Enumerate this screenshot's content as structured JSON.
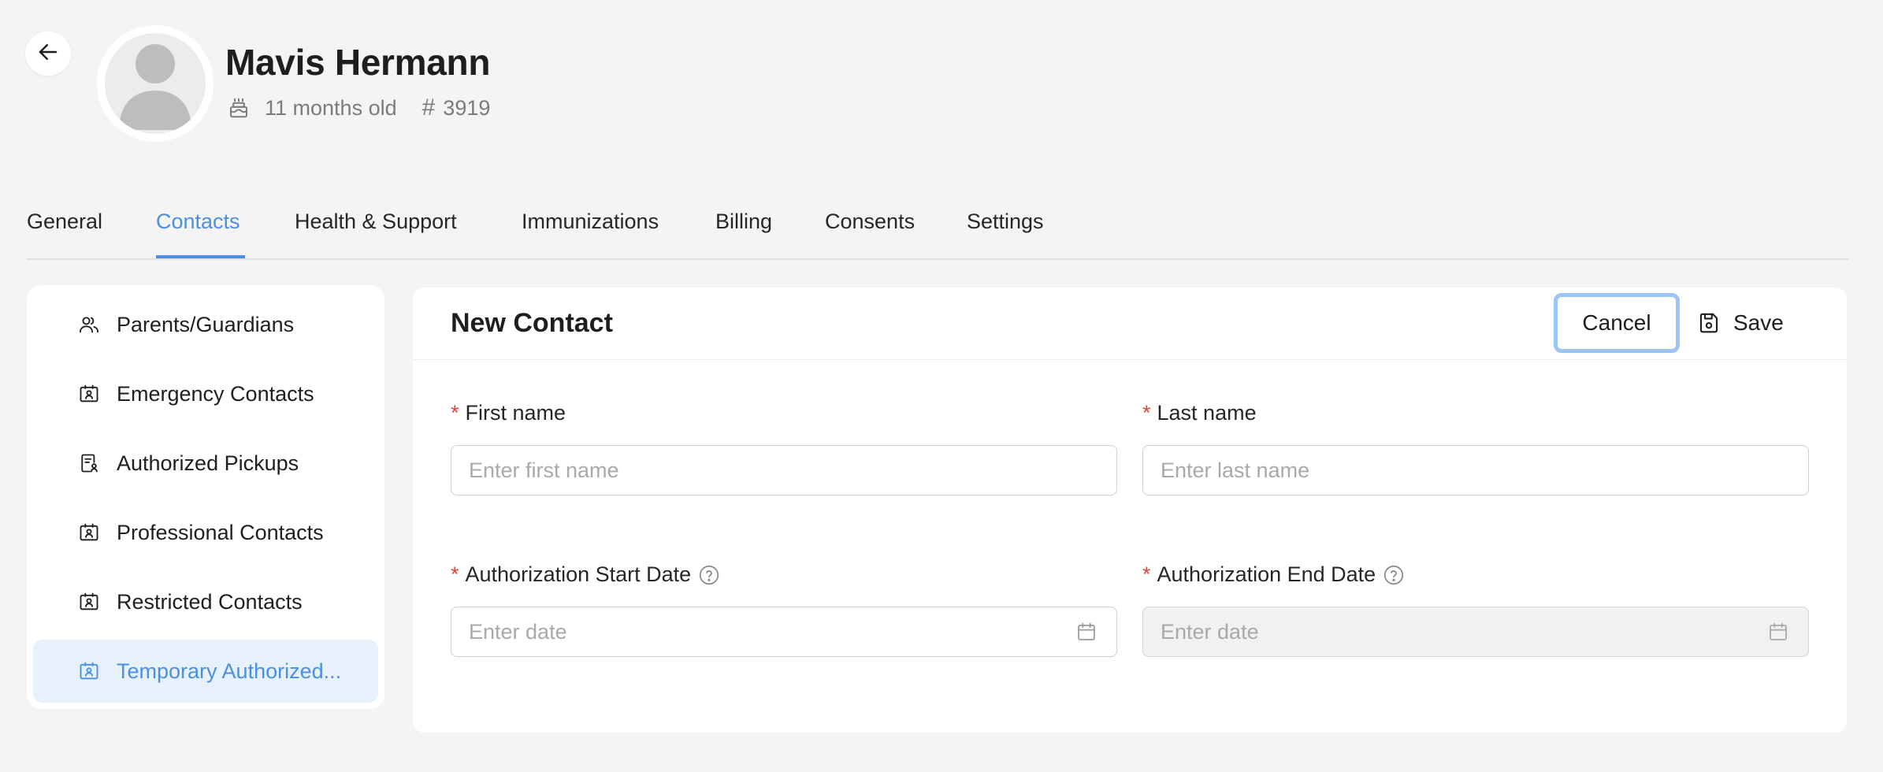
{
  "profile": {
    "name": "Mavis Hermann",
    "age": "11 months old",
    "id_number": "3919",
    "icons": {
      "back": "arrow-left-icon",
      "avatar": "user-silhouette-icon",
      "age": "birthday-cake-icon",
      "id": "hash-icon"
    }
  },
  "tabs": [
    {
      "label": "General",
      "active": false
    },
    {
      "label": "Contacts",
      "active": true
    },
    {
      "label": "Health & Support",
      "active": false
    },
    {
      "label": "Immunizations",
      "active": false
    },
    {
      "label": "Billing",
      "active": false
    },
    {
      "label": "Consents",
      "active": false
    },
    {
      "label": "Settings",
      "active": false
    }
  ],
  "sidebar": {
    "items": [
      {
        "label": "Parents/Guardians",
        "icon": "people-icon",
        "active": false
      },
      {
        "label": "Emergency Contacts",
        "icon": "contact-card-icon",
        "active": false
      },
      {
        "label": "Authorized Pickups",
        "icon": "document-user-icon",
        "active": false
      },
      {
        "label": "Professional Contacts",
        "icon": "contact-card-icon",
        "active": false
      },
      {
        "label": "Restricted Contacts",
        "icon": "contact-card-icon",
        "active": false
      },
      {
        "label": "Temporary Authorized...",
        "icon": "contact-card-icon",
        "active": true
      }
    ]
  },
  "form": {
    "title": "New Contact",
    "cancel_label": "Cancel",
    "save_label": "Save",
    "first_name": {
      "label": "First name",
      "placeholder": "Enter first name",
      "value": ""
    },
    "last_name": {
      "label": "Last name",
      "placeholder": "Enter last name",
      "value": ""
    },
    "start_date": {
      "label": "Authorization Start Date",
      "placeholder": "Enter date",
      "value": ""
    },
    "end_date": {
      "label": "Authorization End Date",
      "placeholder": "Enter date",
      "value": "",
      "disabled": true
    },
    "required_mark": "*"
  },
  "colors": {
    "accent": "#4a8fe2",
    "required": "#e0443c",
    "active_bg": "#e6f1fc",
    "focus_ring": "#9cc5f3",
    "background": "#f4f4f4"
  }
}
